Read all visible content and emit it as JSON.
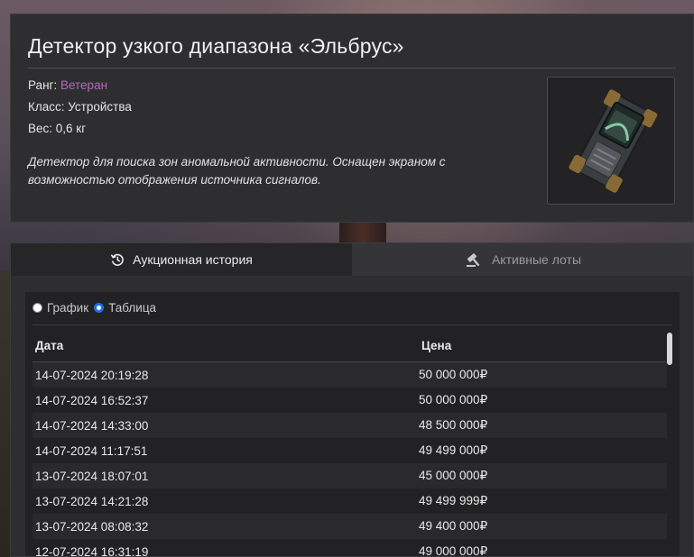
{
  "item": {
    "title": "Детектор узкого диапазона «Эльбрус»",
    "rank_label": "Ранг: ",
    "rank_value": "Ветеран",
    "class_line": "Класс: Устройства",
    "weight_line": "Вес: 0,6 кг",
    "description": "Детектор для поиска зон аномальной активности. Оснащен экраном с возможностью отображения источника сигналов.",
    "rank_color": "#b06bb8"
  },
  "tabs": {
    "history_label": "Аукционная история",
    "lots_label": "Активные лоты",
    "history_icon": "history-icon",
    "lots_icon": "gavel-icon"
  },
  "view": {
    "chart_label": "График",
    "table_label": "Таблица",
    "selected": "Таблица"
  },
  "table": {
    "date_header": "Дата",
    "price_header": "Цена",
    "rows": [
      {
        "date": "14-07-2024 20:19:28",
        "price": "50 000 000₽"
      },
      {
        "date": "14-07-2024 16:52:37",
        "price": "50 000 000₽"
      },
      {
        "date": "14-07-2024 14:33:00",
        "price": "48 500 000₽"
      },
      {
        "date": "14-07-2024 11:17:51",
        "price": "49 499 000₽"
      },
      {
        "date": "13-07-2024 18:07:01",
        "price": "45 000 000₽"
      },
      {
        "date": "13-07-2024 14:21:28",
        "price": "49 499 999₽"
      },
      {
        "date": "13-07-2024 08:08:32",
        "price": "49 400 000₽"
      },
      {
        "date": "12-07-2024 16:31:19",
        "price": "49 000 000₽"
      }
    ]
  }
}
